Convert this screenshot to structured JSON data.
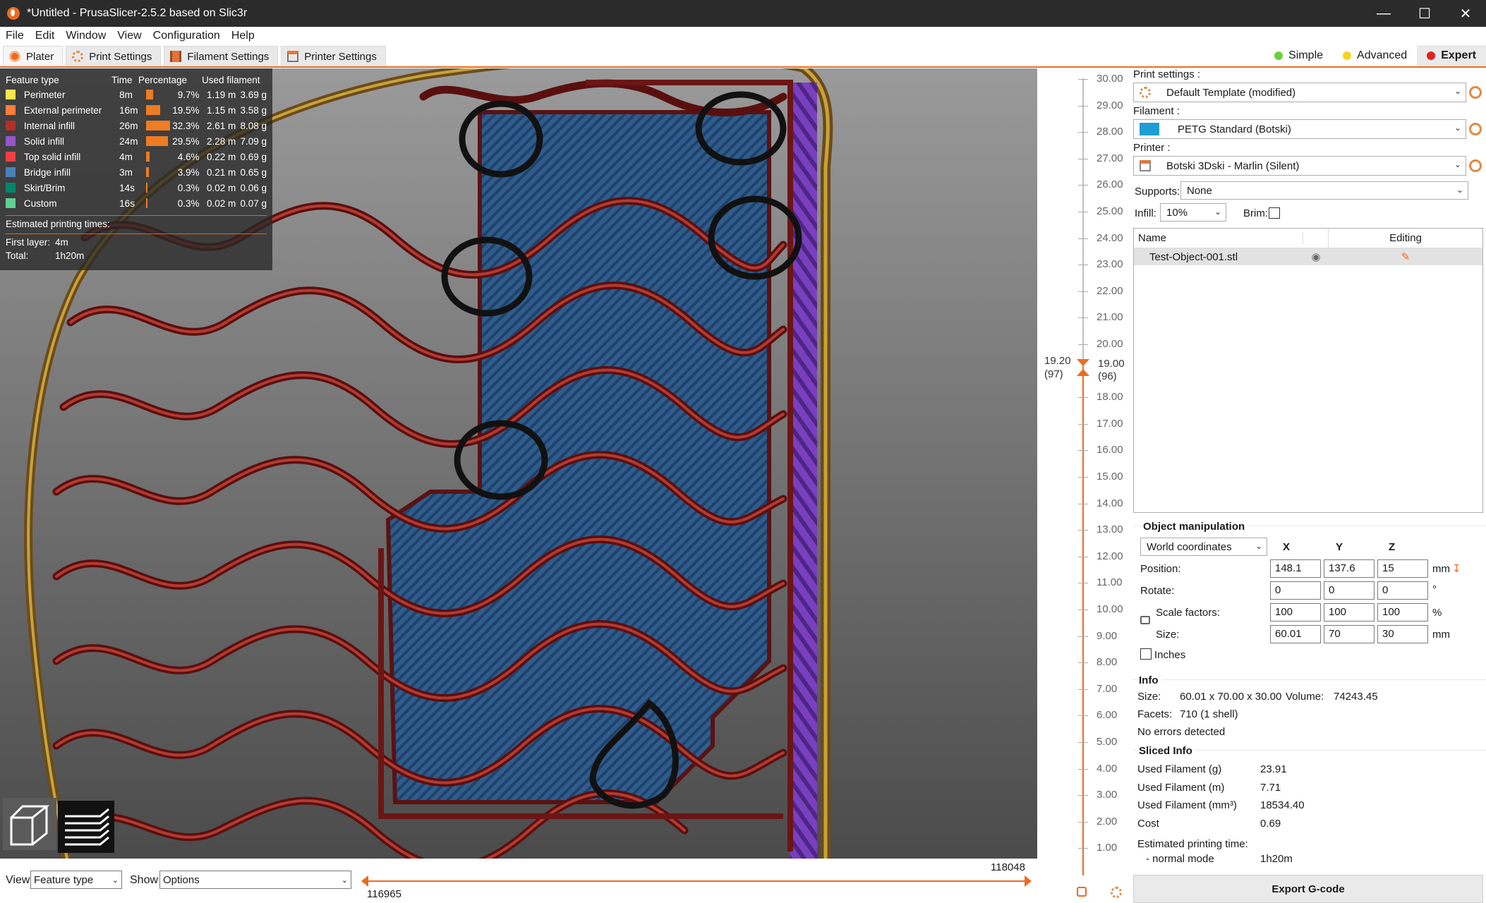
{
  "window": {
    "title": "*Untitled - PrusaSlicer-2.5.2 based on Slic3r"
  },
  "menu": [
    "File",
    "Edit",
    "Window",
    "View",
    "Configuration",
    "Help"
  ],
  "tabs": [
    {
      "label": "Plater",
      "icon": "plater-icon"
    },
    {
      "label": "Print Settings",
      "icon": "gear-icon"
    },
    {
      "label": "Filament Settings",
      "icon": "spool-icon"
    },
    {
      "label": "Printer Settings",
      "icon": "printer-icon"
    }
  ],
  "modes": [
    {
      "label": "Simple",
      "color": "#67d23b"
    },
    {
      "label": "Advanced",
      "color": "#f7d51f"
    },
    {
      "label": "Expert",
      "color": "#e3201f"
    }
  ],
  "legend": {
    "headers": {
      "type": "Feature type",
      "time": "Time",
      "pct": "Percentage",
      "filament": "Used filament"
    },
    "rows": [
      {
        "name": "Perimeter",
        "color": "#ffe64d",
        "time": "8m",
        "pct": "9.7%",
        "pct_value": 9.7,
        "len": "1.19 m",
        "weight": "3.69 g"
      },
      {
        "name": "External perimeter",
        "color": "#ff7d38",
        "time": "16m",
        "pct": "19.5%",
        "pct_value": 19.5,
        "len": "1.15 m",
        "weight": "3.58 g"
      },
      {
        "name": "Internal infill",
        "color": "#b03029",
        "time": "26m",
        "pct": "32.3%",
        "pct_value": 32.3,
        "len": "2.61 m",
        "weight": "8.08 g"
      },
      {
        "name": "Solid infill",
        "color": "#9654cc",
        "time": "24m",
        "pct": "29.5%",
        "pct_value": 29.5,
        "len": "2.28 m",
        "weight": "7.09 g"
      },
      {
        "name": "Top solid infill",
        "color": "#f04040",
        "time": "4m",
        "pct": "4.6%",
        "pct_value": 4.6,
        "len": "0.22 m",
        "weight": "0.69 g"
      },
      {
        "name": "Bridge infill",
        "color": "#4d80ba",
        "time": "3m",
        "pct": "3.9%",
        "pct_value": 3.9,
        "len": "0.21 m",
        "weight": "0.65 g"
      },
      {
        "name": "Skirt/Brim",
        "color": "#00876e",
        "time": "14s",
        "pct": "0.3%",
        "pct_value": 0.3,
        "len": "0.02 m",
        "weight": "0.06 g"
      },
      {
        "name": "Custom",
        "color": "#5ed194",
        "time": "16s",
        "pct": "0.3%",
        "pct_value": 0.3,
        "len": "0.02 m",
        "weight": "0.07 g"
      }
    ],
    "est_label": "Estimated printing times:",
    "first_layer_label": "First layer:",
    "first_layer": "4m",
    "total_label": "Total:",
    "total": "1h20m"
  },
  "bottom": {
    "view_label": "View",
    "view_value": "Feature type",
    "show_label": "Show",
    "show_value": "Options",
    "hslider_left": "116965",
    "hslider_right": "118048"
  },
  "vslider": {
    "ticks": [
      "30.00",
      "29.00",
      "28.00",
      "27.00",
      "26.00",
      "25.00",
      "24.00",
      "23.00",
      "22.00",
      "21.00",
      "20.00",
      "19.00",
      "18.00",
      "17.00",
      "16.00",
      "15.00",
      "14.00",
      "13.00",
      "12.00",
      "11.00",
      "10.00",
      "9.00",
      "8.00",
      "7.00",
      "6.00",
      "5.00",
      "4.00",
      "3.00",
      "2.00",
      "1.00"
    ],
    "upper_value": "19.20",
    "upper_layer": "(97)",
    "lower_value": "19.00",
    "lower_layer": "(96)"
  },
  "right": {
    "print_label": "Print settings :",
    "print_value": "Default Template (modified)",
    "filament_label": "Filament :",
    "filament_value": "PETG Standard (Botski)",
    "filament_color": "#1e9ed4",
    "printer_label": "Printer :",
    "printer_value": "Botski 3Dski - Marlin (Silent)",
    "supports_label": "Supports:",
    "supports_value": "None",
    "infill_label": "Infill:",
    "infill_value": "10%",
    "brim_label": "Brim:",
    "list_name_header": "Name",
    "list_editing_header": "Editing",
    "object_name": "Test-Object-001.stl",
    "om_title": "Object manipulation",
    "coords": "World coordinates",
    "x": "X",
    "y": "Y",
    "z": "Z",
    "position_label": "Position:",
    "position": [
      "148.1",
      "137.6",
      "15"
    ],
    "position_unit": "mm",
    "rotate_label": "Rotate:",
    "rotate": [
      "0",
      "0",
      "0"
    ],
    "rotate_unit": "°",
    "scale_label": "Scale factors:",
    "scale": [
      "100",
      "100",
      "100"
    ],
    "scale_unit": "%",
    "size_label": "Size:",
    "size": [
      "60.01",
      "70",
      "30"
    ],
    "size_unit": "mm",
    "inches_label": "Inches",
    "info_title": "Info",
    "info_size_label": "Size:",
    "info_size": "60.01 x 70.00 x 30.00",
    "info_volume_label": "Volume:",
    "info_volume": "74243.45",
    "info_facets_label": "Facets:",
    "info_facets": "710 (1 shell)",
    "info_errors": "No errors detected",
    "sliced_title": "Sliced Info",
    "sliced": [
      {
        "label": "Used Filament (g)",
        "value": "23.91"
      },
      {
        "label": "Used Filament (m)",
        "value": "7.71"
      },
      {
        "label": "Used Filament (mm³)",
        "value": "18534.40"
      },
      {
        "label": "Cost",
        "value": "0.69"
      }
    ],
    "est_time_label": "Estimated printing time:",
    "normal_mode_label": "- normal mode",
    "normal_mode_value": "1h20m",
    "export_label": "Export G-code"
  }
}
